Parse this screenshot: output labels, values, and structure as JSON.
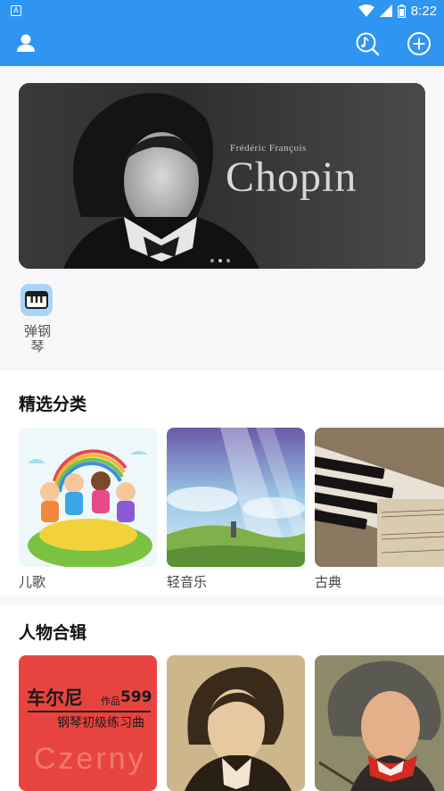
{
  "status_bar": {
    "app_badge": "A",
    "time": "8:22"
  },
  "app_bar": {
    "icons": [
      "user-icon",
      "music-search-icon",
      "add-circle-icon"
    ]
  },
  "banner": {
    "subtitle": "Frédéric François",
    "title": "Chopin",
    "page_count": 3,
    "active_page": 1
  },
  "quick_entry": {
    "label": "弹钢琴",
    "icon": "piano-icon",
    "color": "#aad4f5"
  },
  "categories": {
    "title": "精选分类",
    "items": [
      {
        "label": "儿歌"
      },
      {
        "label": "轻音乐"
      },
      {
        "label": "古典"
      }
    ]
  },
  "people": {
    "title": "人物合辑",
    "czerny": {
      "name": "车尔尼",
      "opus_prefix": "作品",
      "opus_number": "599",
      "subtitle": "钢琴初级练习曲",
      "watermark": "Czerny"
    }
  },
  "colors": {
    "primary": "#2f95f3",
    "czerny_red": "#e8443f"
  }
}
